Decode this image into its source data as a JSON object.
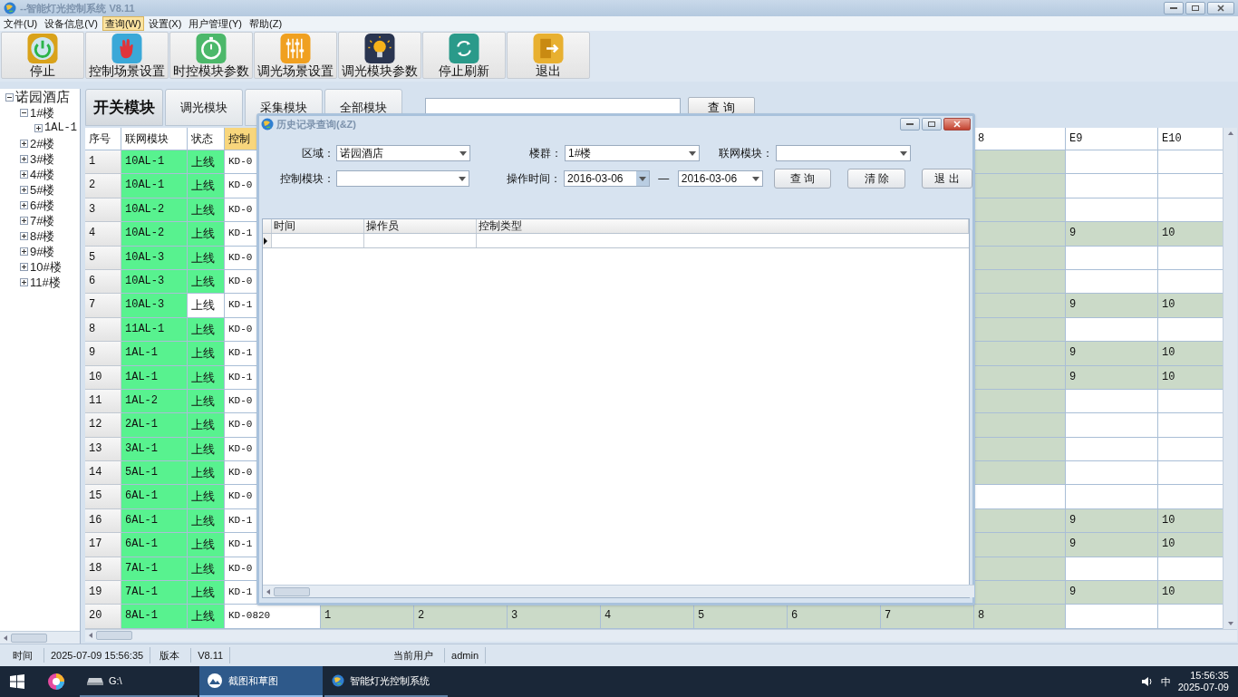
{
  "window": {
    "title": "--智能灯光控制系统 V8.11"
  },
  "menu": [
    {
      "label": "文件(U)",
      "selected": false
    },
    {
      "label": "设备信息(V)",
      "selected": false
    },
    {
      "label": "查询(W)",
      "selected": true
    },
    {
      "label": "设置(X)",
      "selected": false
    },
    {
      "label": "用户管理(Y)",
      "selected": false
    },
    {
      "label": "帮助(Z)",
      "selected": false
    }
  ],
  "toolbar": [
    {
      "label": "停止"
    },
    {
      "label": "控制场景设置"
    },
    {
      "label": "时控模块参数"
    },
    {
      "label": "调光场景设置"
    },
    {
      "label": "调光模块参数"
    },
    {
      "label": "停止刷新"
    },
    {
      "label": "退出"
    }
  ],
  "tree": {
    "label": "诺园酒店",
    "expanded": true,
    "children": [
      {
        "label": "1#楼",
        "expanded": true,
        "children": [
          {
            "label": "1AL-1",
            "expanded": false
          }
        ]
      },
      {
        "label": "2#楼",
        "expanded": false
      },
      {
        "label": "3#楼",
        "expanded": false
      },
      {
        "label": "4#楼",
        "expanded": false
      },
      {
        "label": "5#楼",
        "expanded": false
      },
      {
        "label": "6#楼",
        "expanded": false
      },
      {
        "label": "7#楼",
        "expanded": false
      },
      {
        "label": "8#楼",
        "expanded": false
      },
      {
        "label": "9#楼",
        "expanded": false
      },
      {
        "label": "10#楼",
        "expanded": false
      },
      {
        "label": "11#楼",
        "expanded": false
      }
    ]
  },
  "module_tabs": [
    {
      "label": "开关模块",
      "selected": true
    },
    {
      "label": "调光模块",
      "selected": false
    },
    {
      "label": "采集模块",
      "selected": false
    },
    {
      "label": "全部模块",
      "selected": false
    }
  ],
  "search": {
    "button": "查 询"
  },
  "table": {
    "columns": [
      {
        "label": "序号",
        "sorted": false
      },
      {
        "label": "联网模块",
        "sorted": false
      },
      {
        "label": "状态",
        "sorted": false
      },
      {
        "label": "控制",
        "sorted": true
      },
      null,
      null,
      null,
      null,
      null,
      null,
      null,
      {
        "label": "8",
        "sorted": false
      },
      {
        "label": "E9",
        "sorted": false
      },
      {
        "label": "E10",
        "sorted": false
      }
    ],
    "rows": [
      {
        "no": "1",
        "network": "10AL-1",
        "status": "上线",
        "lit": true,
        "control": "KD-0",
        "cells": [
          {
            "lit": true
          },
          {
            "lit": false
          },
          {
            "lit": false
          }
        ]
      },
      {
        "no": "2",
        "network": "10AL-1",
        "status": "上线",
        "lit": true,
        "control": "KD-0",
        "cells": [
          {
            "lit": true
          },
          {
            "lit": false
          },
          {
            "lit": false
          }
        ]
      },
      {
        "no": "3",
        "network": "10AL-2",
        "status": "上线",
        "lit": true,
        "control": "KD-0",
        "cells": [
          {
            "lit": true
          },
          {
            "lit": false
          },
          {
            "lit": false
          }
        ]
      },
      {
        "no": "4",
        "network": "10AL-2",
        "status": "上线",
        "lit": true,
        "control": "KD-1",
        "cells": [
          {
            "lit": true
          },
          {
            "text": "9",
            "lit": true
          },
          {
            "text": "10",
            "lit": true
          }
        ]
      },
      {
        "no": "5",
        "network": "10AL-3",
        "status": "上线",
        "lit": true,
        "control": "KD-0",
        "cells": [
          {
            "lit": true
          },
          {
            "lit": false
          },
          {
            "lit": false
          }
        ]
      },
      {
        "no": "6",
        "network": "10AL-3",
        "status": "上线",
        "lit": true,
        "control": "KD-0",
        "cells": [
          {
            "lit": true
          },
          {
            "lit": false
          },
          {
            "lit": false
          }
        ]
      },
      {
        "no": "7",
        "network": "10AL-3",
        "status": "上线",
        "lit": false,
        "control": "KD-1",
        "cells": [
          {
            "lit": true
          },
          {
            "text": "9",
            "lit": true
          },
          {
            "text": "10",
            "lit": true
          }
        ]
      },
      {
        "no": "8",
        "network": "11AL-1",
        "status": "上线",
        "lit": true,
        "control": "KD-0",
        "cells": [
          {
            "lit": true
          },
          {
            "lit": false
          },
          {
            "lit": false
          }
        ]
      },
      {
        "no": "9",
        "network": "1AL-1",
        "status": "上线",
        "lit": true,
        "control": "KD-1",
        "cells": [
          {
            "lit": true
          },
          {
            "text": "9",
            "lit": true
          },
          {
            "text": "10",
            "lit": true
          }
        ]
      },
      {
        "no": "10",
        "network": "1AL-1",
        "status": "上线",
        "lit": true,
        "control": "KD-1",
        "cells": [
          {
            "lit": true
          },
          {
            "text": "9",
            "lit": true
          },
          {
            "text": "10",
            "lit": true
          }
        ]
      },
      {
        "no": "11",
        "network": "1AL-2",
        "status": "上线",
        "lit": true,
        "control": "KD-0",
        "cells": [
          {
            "lit": true
          },
          {
            "lit": false
          },
          {
            "lit": false
          }
        ]
      },
      {
        "no": "12",
        "network": "2AL-1",
        "status": "上线",
        "lit": true,
        "control": "KD-0",
        "cells": [
          {
            "lit": true
          },
          {
            "lit": false
          },
          {
            "lit": false
          }
        ]
      },
      {
        "no": "13",
        "network": "3AL-1",
        "status": "上线",
        "lit": true,
        "control": "KD-0",
        "cells": [
          {
            "lit": true
          },
          {
            "lit": false
          },
          {
            "lit": false
          }
        ]
      },
      {
        "no": "14",
        "network": "5AL-1",
        "status": "上线",
        "lit": true,
        "control": "KD-0",
        "cells": [
          {
            "lit": true
          },
          {
            "lit": false
          },
          {
            "lit": false
          }
        ]
      },
      {
        "no": "15",
        "network": "6AL-1",
        "status": "上线",
        "lit": true,
        "control": "KD-0",
        "cells": [
          {
            "lit": false
          },
          {
            "lit": false
          },
          {
            "lit": false
          }
        ]
      },
      {
        "no": "16",
        "network": "6AL-1",
        "status": "上线",
        "lit": true,
        "control": "KD-1",
        "cells": [
          {
            "lit": true
          },
          {
            "text": "9",
            "lit": true
          },
          {
            "text": "10",
            "lit": true
          }
        ]
      },
      {
        "no": "17",
        "network": "6AL-1",
        "status": "上线",
        "lit": true,
        "control": "KD-1",
        "cells": [
          {
            "lit": true
          },
          {
            "text": "9",
            "lit": true
          },
          {
            "text": "10",
            "lit": true
          }
        ]
      },
      {
        "no": "18",
        "network": "7AL-1",
        "status": "上线",
        "lit": true,
        "control": "KD-0",
        "cells": [
          {
            "lit": true
          },
          {
            "lit": false
          },
          {
            "lit": false
          }
        ]
      },
      {
        "no": "19",
        "network": "7AL-1",
        "status": "上线",
        "lit": true,
        "control": "KD-1",
        "cells": [
          {
            "lit": true
          },
          {
            "text": "9",
            "lit": true
          },
          {
            "text": "10",
            "lit": true
          }
        ]
      },
      {
        "no": "20",
        "network": "8AL-1",
        "status": "上线",
        "lit": true,
        "control": "KD-0820",
        "cells": [
          {
            "text": "1",
            "lit": true
          },
          {
            "text": "2",
            "lit": true
          },
          {
            "text": "3",
            "lit": true
          },
          {
            "text": "4",
            "lit": true
          },
          {
            "text": "5",
            "lit": true
          },
          {
            "text": "6",
            "lit": true
          },
          {
            "text": "7",
            "lit": true
          },
          {
            "text": "8",
            "lit": true
          },
          {
            "lit": false
          },
          {
            "lit": false
          }
        ]
      }
    ]
  },
  "dialog": {
    "title": "历史记录查询(&Z)",
    "fields": [
      {
        "label": "区域：",
        "value": "诺园酒店"
      },
      {
        "label": "楼群：",
        "value": "1#楼"
      },
      {
        "label": "联网模块："
      },
      {
        "label": "控制模块："
      }
    ],
    "time": {
      "label": "操作时间：",
      "from": "2016-03-06",
      "separator": "—",
      "to": "2016-03-06"
    },
    "buttons": [
      "查 询",
      "清 除",
      "退 出"
    ],
    "grid_columns": [
      "时间",
      "操作员",
      "控制类型"
    ]
  },
  "status_bar": [
    {
      "label": "时间",
      "value": "2025-07-09 15:56:35"
    },
    {
      "label": "版本",
      "value": "V8.11"
    },
    {
      "label": "当前用户",
      "value": "admin"
    }
  ],
  "taskbar": {
    "apps": [
      {
        "label": "G:\\",
        "selected": false
      },
      {
        "label": "截图和草图",
        "selected": true
      },
      {
        "label": "智能灯光控制系统",
        "selected": false
      }
    ],
    "tray": {
      "ime": "中",
      "time": "15:56:35",
      "date": "2025-07-09"
    }
  }
}
